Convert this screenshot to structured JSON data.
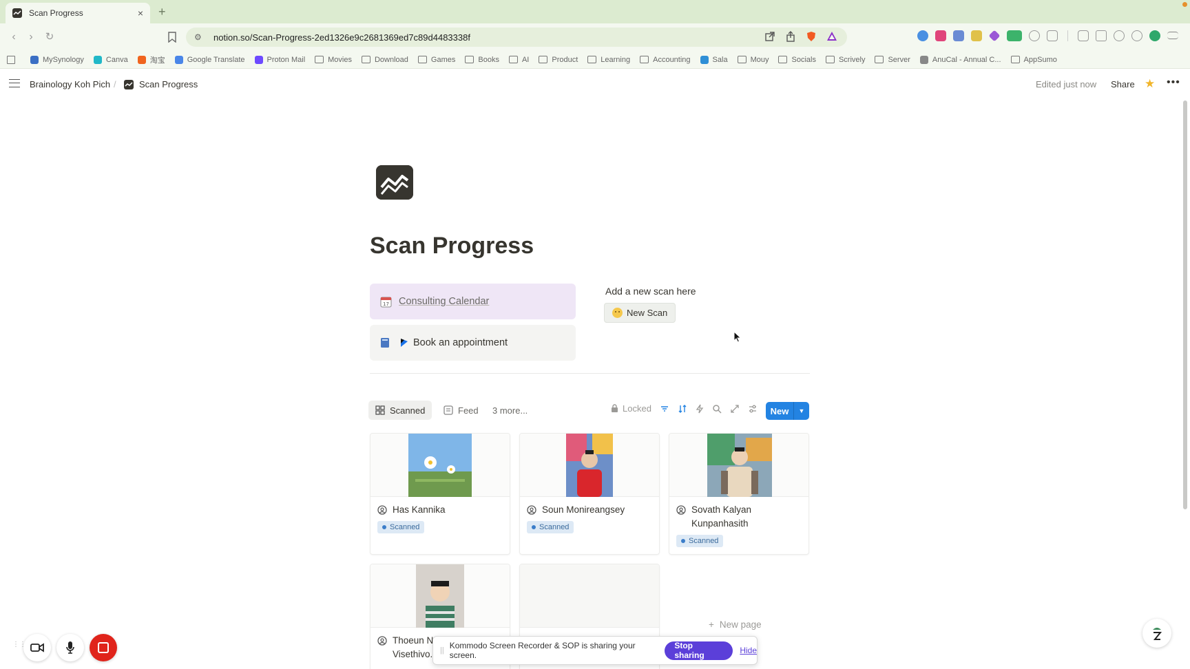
{
  "browser": {
    "tab_title": "Scan Progress",
    "tab_close": "×",
    "new_tab": "+",
    "url": "notion.so/Scan-Progress-2ed1326e9c2681369ed7c89d4483338f",
    "bookmarks": [
      {
        "label": "MySynology",
        "color": "#3b6fc4"
      },
      {
        "label": "Canva",
        "color": "#21b8c8"
      },
      {
        "label": "淘宝",
        "color": "#f0641e"
      },
      {
        "label": "Google Translate",
        "color": "#4a86e8"
      },
      {
        "label": "Proton Mail",
        "color": "#6d4aff"
      },
      {
        "label": "Movies",
        "color": ""
      },
      {
        "label": "Download",
        "color": ""
      },
      {
        "label": "Games",
        "color": ""
      },
      {
        "label": "Books",
        "color": ""
      },
      {
        "label": "AI",
        "color": ""
      },
      {
        "label": "Product",
        "color": ""
      },
      {
        "label": "Learning",
        "color": ""
      },
      {
        "label": "Accounting",
        "color": ""
      },
      {
        "label": "Sala",
        "color": "#2f8fd6"
      },
      {
        "label": "Mouy",
        "color": ""
      },
      {
        "label": "Socials",
        "color": ""
      },
      {
        "label": "Scrively",
        "color": ""
      },
      {
        "label": "Server",
        "color": ""
      },
      {
        "label": "AnuCal - Annual C...",
        "color": "#888888"
      },
      {
        "label": "AppSumo",
        "color": ""
      }
    ]
  },
  "topbar": {
    "workspace": "Brainology Koh Pich",
    "separator": "/",
    "page": "Scan Progress",
    "edited": "Edited just now",
    "share": "Share",
    "more": "•••"
  },
  "page": {
    "title": "Scan Progress",
    "callout_calendar": "Consulting Calendar",
    "callout_book": "Book an appointment",
    "add_scan_text": "Add a new scan here",
    "new_scan_button": "New Scan"
  },
  "database": {
    "views": {
      "active": "Scanned",
      "feed": "Feed",
      "more": "3 more..."
    },
    "locked": "Locked",
    "new_button": "New",
    "new_page": "New page",
    "cards": [
      {
        "name": "Has Kannika",
        "status": "Scanned"
      },
      {
        "name": "Soun Monireangsey",
        "status": "Scanned"
      },
      {
        "name": "Sovath Kalyan Kunpanhasith",
        "status": "Scanned"
      },
      {
        "name": "Thoeun N... Visethivo...",
        "status": ""
      },
      {
        "name": "",
        "status": ""
      }
    ]
  },
  "screenshare": {
    "message": "Kommodo Screen Recorder & SOP is sharing your screen.",
    "stop": "Stop sharing",
    "hide": "Hide"
  },
  "colors": {
    "accent_blue": "#2383e2",
    "callout_purple": "#efe6f6",
    "badge_bg": "#dde9f5",
    "share_purple": "#5b3fd9",
    "record_red": "#e0241b",
    "favorite_star": "#f1b52b"
  }
}
